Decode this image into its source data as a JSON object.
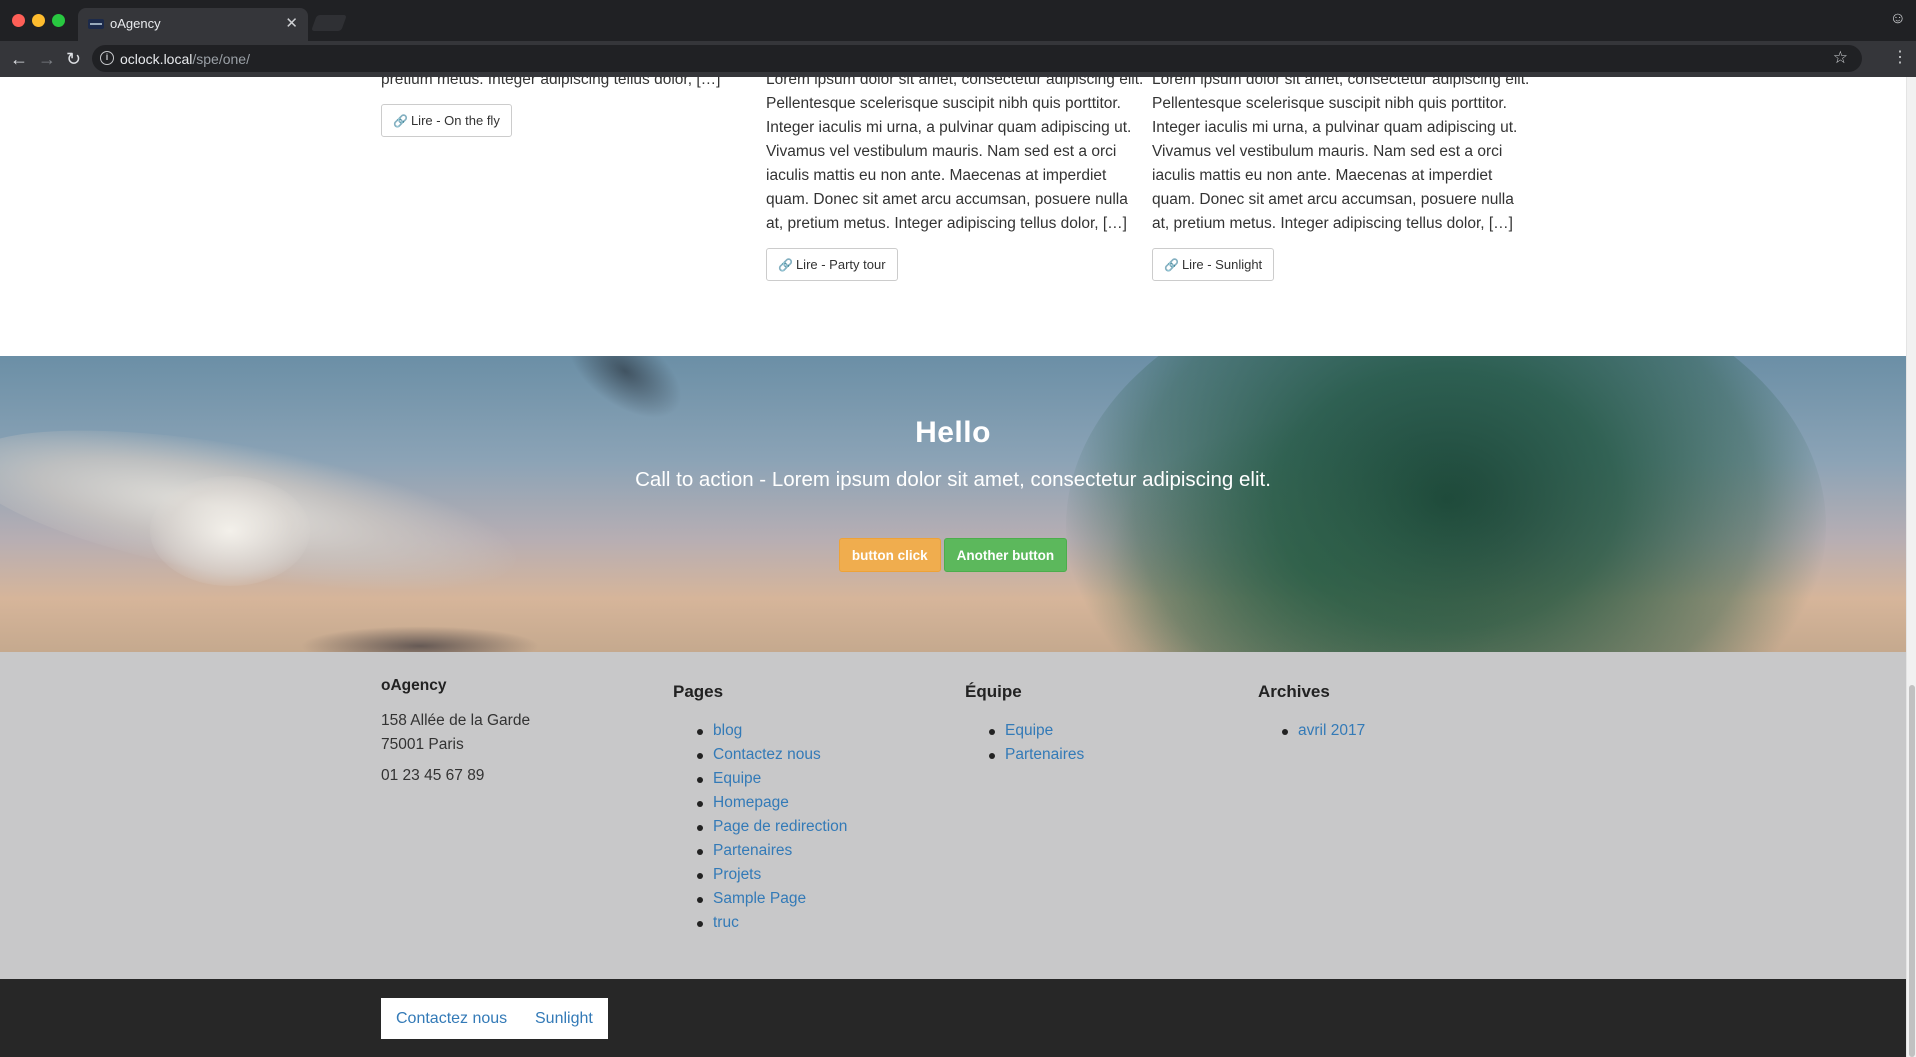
{
  "browser": {
    "tab_title": "oAgency",
    "url_host": "oclock.local",
    "url_path": "/spe/one/"
  },
  "posts": [
    {
      "text": "pretium metus. Integer adipiscing tellus dolor, […]",
      "button": "Lire - On the fly"
    },
    {
      "text": "Lorem ipsum dolor sit amet, consectetur adipiscing elit. Pellentesque scelerisque suscipit nibh quis porttitor. Integer iaculis mi urna, a pulvinar quam adipiscing ut. Vivamus vel vestibulum mauris. Nam sed est a orci iaculis mattis eu non ante. Maecenas at imperdiet quam. Donec sit amet arcu accumsan, posuere nulla at, pretium metus. Integer adipiscing tellus dolor, […]",
      "button": "Lire - Party tour"
    },
    {
      "text": "Lorem ipsum dolor sit amet, consectetur adipiscing elit. Pellentesque scelerisque suscipit nibh quis porttitor. Integer iaculis mi urna, a pulvinar quam adipiscing ut. Vivamus vel vestibulum mauris. Nam sed est a orci iaculis mattis eu non ante. Maecenas at imperdiet quam. Donec sit amet arcu accumsan, posuere nulla at, pretium metus. Integer adipiscing tellus dolor, […]",
      "button": "Lire - Sunlight"
    }
  ],
  "cta": {
    "title": "Hello",
    "subtitle": "Call to action - Lorem ipsum dolor sit amet, consectetur adipiscing elit.",
    "button_primary": "button click",
    "button_secondary": "Another button",
    "colors": {
      "primary": "#f0ad4e",
      "secondary": "#5cb85c"
    }
  },
  "footer": {
    "brand": "oAgency",
    "address_line1": "158 Allée de la Garde",
    "address_line2": "75001 Paris",
    "phone": "01 23 45 67 89",
    "pages": {
      "title": "Pages",
      "items": [
        "blog",
        "Contactez nous",
        "Equipe",
        "Homepage",
        "Page de redirection",
        "Partenaires",
        "Projets",
        "Sample Page",
        "truc"
      ]
    },
    "team": {
      "title": "Équipe",
      "items": [
        "Equipe",
        "Partenaires"
      ]
    },
    "archives": {
      "title": "Archives",
      "items": [
        "avril 2017"
      ]
    },
    "link_color": "#337ab7"
  },
  "bottom_nav": {
    "items": [
      "Contactez nous",
      "Sunlight"
    ]
  }
}
